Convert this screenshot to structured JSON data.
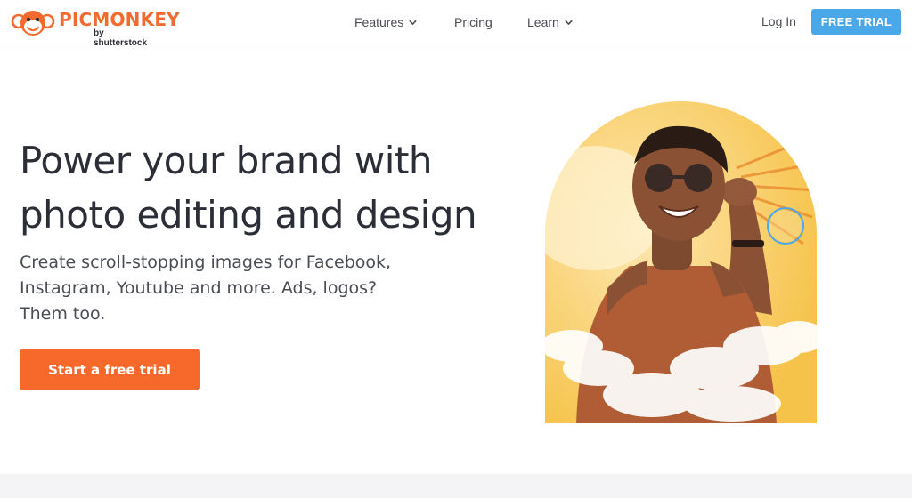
{
  "brand": {
    "name": "PICMONKEY",
    "tagline": "by shutterstock",
    "color": "#f26a2e"
  },
  "nav": {
    "items": [
      {
        "label": "Features",
        "has_dropdown": true
      },
      {
        "label": "Pricing",
        "has_dropdown": false
      },
      {
        "label": "Learn",
        "has_dropdown": true
      }
    ],
    "login_label": "Log In",
    "free_trial_label": "FREE TRIAL",
    "free_trial_color": "#4aa7e8"
  },
  "hero": {
    "headline_lines": [
      "Power your brand with",
      "photo editing and design"
    ],
    "subtext_lines": [
      "Create scroll-stopping images for Facebook,",
      "Instagram, Youtube and more. Ads, logos?",
      "Them too."
    ],
    "cta_label": "Start a free trial",
    "cta_color": "#f7692b",
    "image_icon": "smiling-woman-sunglasses-photo"
  }
}
